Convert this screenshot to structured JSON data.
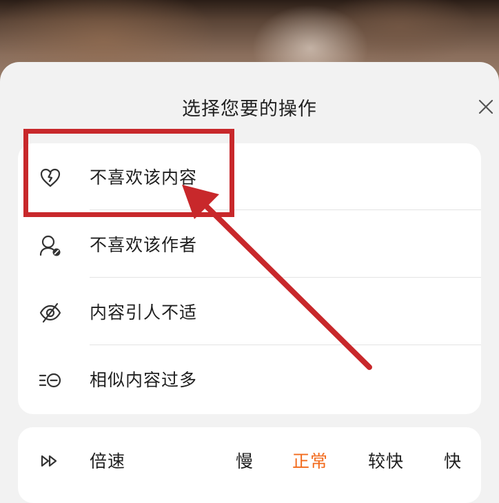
{
  "sheet": {
    "title": "选择您要的操作",
    "close_icon": "close-icon"
  },
  "menu": {
    "items": [
      {
        "label": "不喜欢该内容",
        "icon": "broken-heart-icon"
      },
      {
        "label": "不喜欢该作者",
        "icon": "user-block-icon"
      },
      {
        "label": "内容引人不适",
        "icon": "eye-off-icon"
      },
      {
        "label": "相似内容过多",
        "icon": "list-minus-icon"
      }
    ]
  },
  "speed": {
    "label": "倍速",
    "icon": "fast-forward-icon",
    "options": [
      "慢",
      "正常",
      "较快",
      "快"
    ],
    "selected": "正常"
  },
  "colors": {
    "accent": "#f26b1d",
    "annotation": "#c8282b"
  }
}
